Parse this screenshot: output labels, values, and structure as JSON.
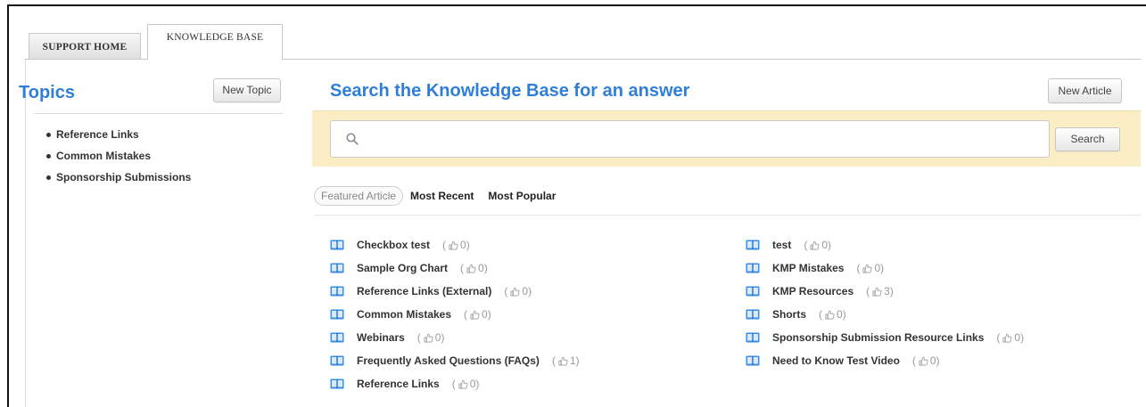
{
  "tabs": [
    {
      "label": "SUPPORT HOME"
    },
    {
      "label": "KNOWLEDGE BASE"
    }
  ],
  "sidebar": {
    "title": "Topics",
    "new_topic_label": "New Topic",
    "topics": [
      {
        "label": "Reference Links"
      },
      {
        "label": "Common Mistakes"
      },
      {
        "label": "Sponsorship Submissions"
      }
    ]
  },
  "main": {
    "title": "Search the Knowledge Base for an answer",
    "new_article_label": "New Article",
    "search": {
      "value": "",
      "placeholder": "",
      "button_label": "Search"
    },
    "filters": {
      "featured": "Featured Article",
      "recent": "Most Recent",
      "popular": "Most Popular"
    },
    "articles_left": [
      {
        "title": "Checkbox test",
        "likes": "0"
      },
      {
        "title": "Sample Org Chart",
        "likes": "0"
      },
      {
        "title": "Reference Links (External)",
        "likes": "0"
      },
      {
        "title": "Common Mistakes",
        "likes": "0"
      },
      {
        "title": "Webinars",
        "likes": "0"
      },
      {
        "title": "Frequently Asked Questions (FAQs)",
        "likes": "1"
      },
      {
        "title": "Reference Links",
        "likes": "0"
      }
    ],
    "articles_right": [
      {
        "title": "test",
        "likes": "0"
      },
      {
        "title": "KMP Mistakes",
        "likes": "0"
      },
      {
        "title": "KMP Resources",
        "likes": "3"
      },
      {
        "title": "Shorts",
        "likes": "0"
      },
      {
        "title": "Sponsorship Submission Resource Links",
        "likes": "0"
      },
      {
        "title": "Need to Know Test Video",
        "likes": "0"
      }
    ]
  },
  "colors": {
    "accent": "#2f7fd8",
    "search_band": "#fbeec5",
    "book_icon": "#3a8ee6"
  }
}
